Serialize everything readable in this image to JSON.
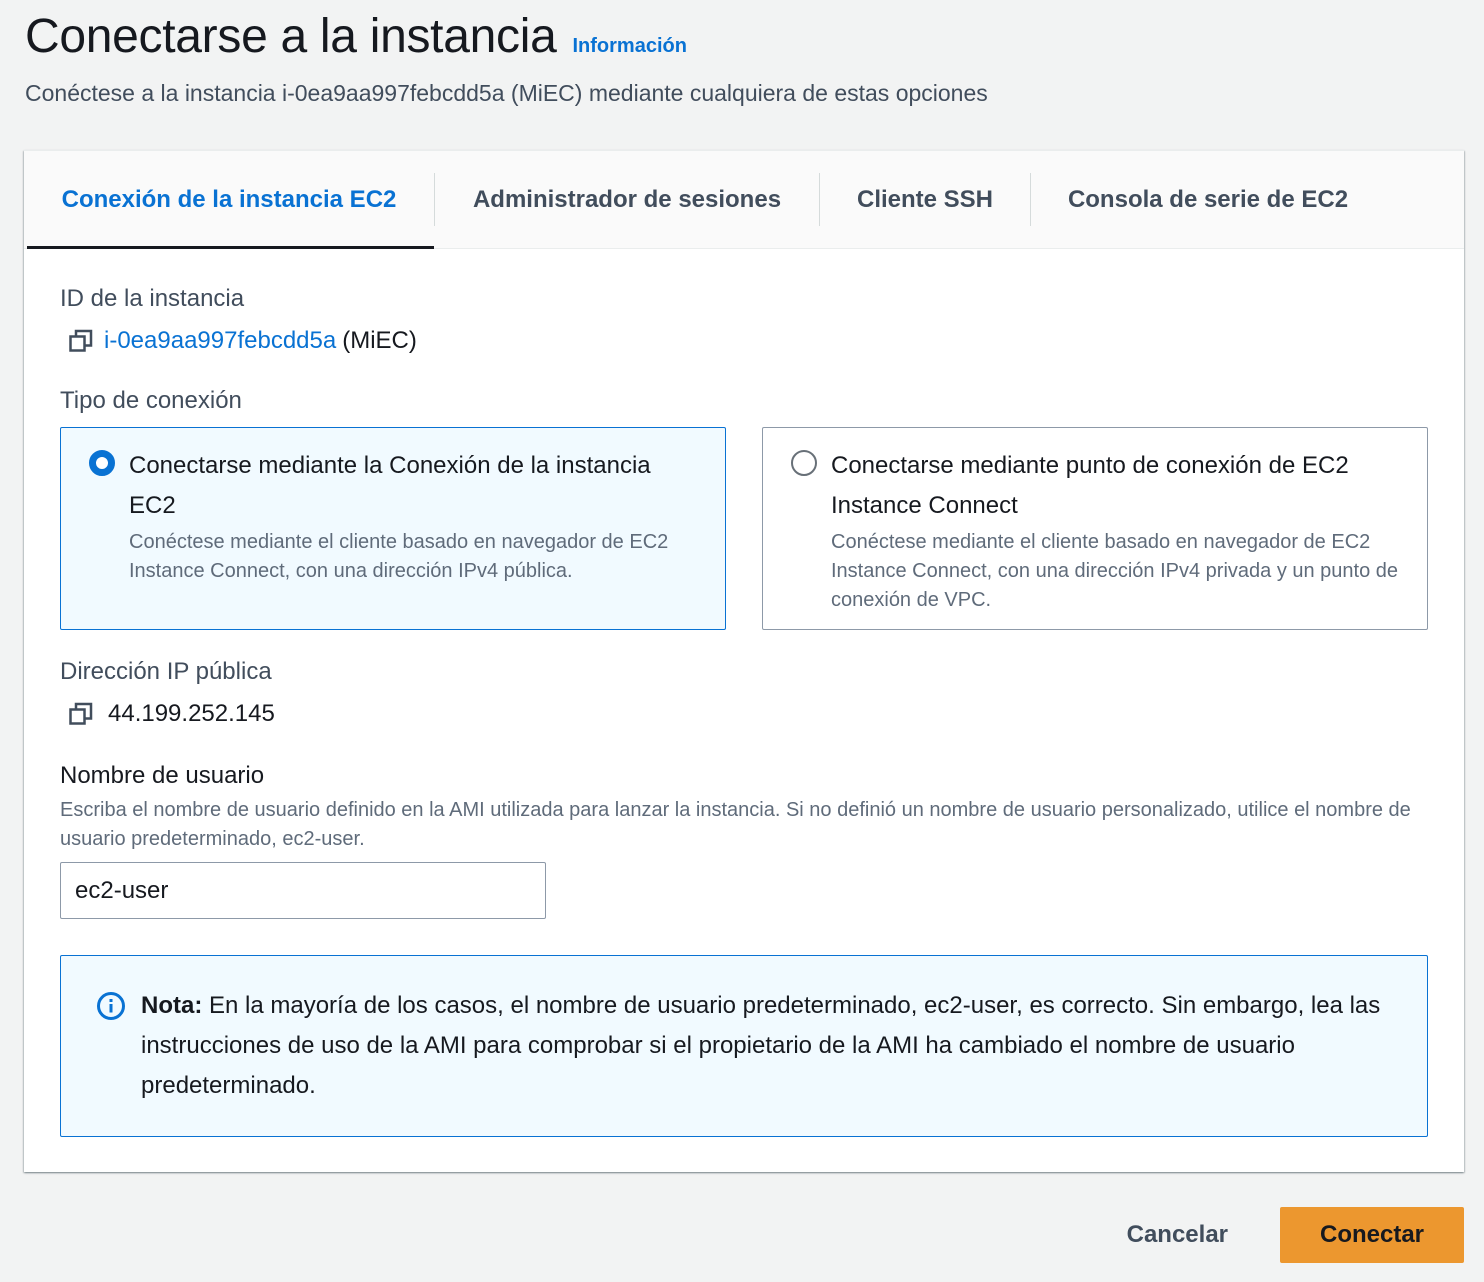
{
  "header": {
    "title": "Conectarse a la instancia",
    "info_link": "Información",
    "subtitle": "Conéctese a la instancia i-0ea9aa997febcdd5a (MiEC) mediante cualquiera de estas opciones"
  },
  "tabs": [
    {
      "label": "Conexión de la instancia EC2",
      "active": true
    },
    {
      "label": "Administrador de sesiones",
      "active": false
    },
    {
      "label": "Cliente SSH",
      "active": false
    },
    {
      "label": "Consola de serie de EC2",
      "active": false
    }
  ],
  "instance": {
    "label": "ID de la instancia",
    "id": "i-0ea9aa997febcdd5a",
    "name": "(MiEC)",
    "copy_icon": "copy-icon"
  },
  "connection_type": {
    "label": "Tipo de conexión",
    "options": [
      {
        "title": "Conectarse mediante la Conexión de la instancia EC2",
        "description": "Conéctese mediante el cliente basado en navegador de EC2 Instance Connect, con una dirección IPv4 pública.",
        "selected": true
      },
      {
        "title": "Conectarse mediante punto de conexión de EC2 Instance Connect",
        "description": "Conéctese mediante el cliente basado en navegador de EC2 Instance Connect, con una dirección IPv4 privada y un punto de conexión de VPC.",
        "selected": false
      }
    ]
  },
  "public_ip": {
    "label": "Dirección IP pública",
    "value": "44.199.252.145"
  },
  "username": {
    "label": "Nombre de usuario",
    "description": "Escriba el nombre de usuario definido en la AMI utilizada para lanzar la instancia. Si no definió un nombre de usuario personalizado, utilice el nombre de usuario predeterminado, ec2-user.",
    "value": "ec2-user"
  },
  "note": {
    "icon": "info-icon",
    "bold": "Nota:",
    "text": " En la mayoría de los casos, el nombre de usuario predeterminado, ec2-user, es correcto. Sin embargo, lea las instrucciones de uso de la AMI para comprobar si el propietario de la AMI ha cambiado el nombre de usuario predeterminado."
  },
  "footer": {
    "cancel": "Cancelar",
    "connect": "Conectar"
  },
  "colors": {
    "accent": "#0972d3",
    "primary_button": "#ec972f",
    "background": "#f2f3f3"
  }
}
